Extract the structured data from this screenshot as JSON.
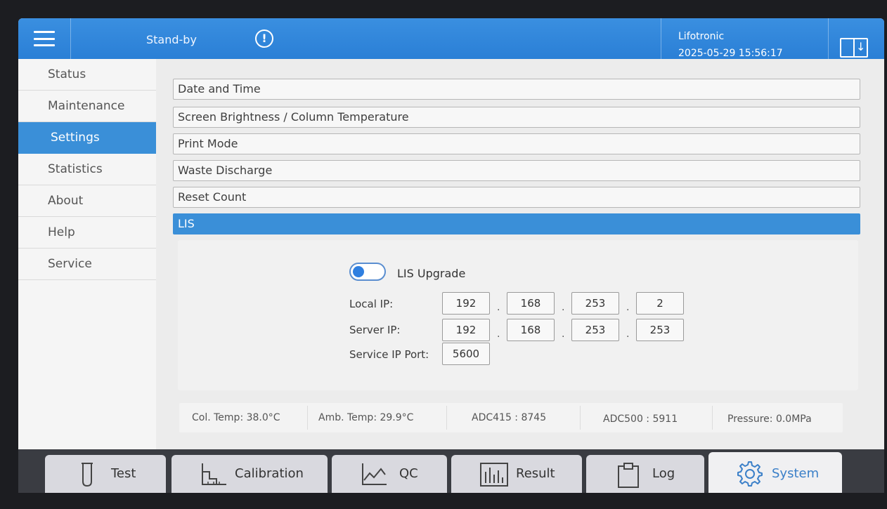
{
  "header": {
    "status": "Stand-by",
    "user": "Lifotronic",
    "datetime": "2025-05-29 15:56:17"
  },
  "sidebar": {
    "items": [
      {
        "label": "Status"
      },
      {
        "label": "Maintenance"
      },
      {
        "label": "Settings",
        "active": true
      },
      {
        "label": "Statistics"
      },
      {
        "label": "About"
      },
      {
        "label": "Help"
      },
      {
        "label": "Service"
      }
    ]
  },
  "settings": {
    "rows": [
      {
        "label": "Date and Time"
      },
      {
        "label": "Screen Brightness / Column Temperature"
      },
      {
        "label": "Print Mode"
      },
      {
        "label": "Waste Discharge"
      },
      {
        "label": "Reset Count"
      },
      {
        "label": "LIS",
        "active": true
      }
    ]
  },
  "lis": {
    "upgrade_label": "LIS Upgrade",
    "upgrade_enabled": false,
    "local_ip_label": "Local IP:",
    "local_ip": [
      "192",
      "168",
      "253",
      "2"
    ],
    "server_ip_label": "Server IP:",
    "server_ip": [
      "192",
      "168",
      "253",
      "253"
    ],
    "port_label": "Service IP Port:",
    "port": "5600",
    "separator": "."
  },
  "statusbar": {
    "col_temp": "Col. Temp:  38.0°C",
    "amb_temp": "Amb. Temp:  29.9°C",
    "adc415": "ADC415  : 8745",
    "adc500": "ADC500  : 5911",
    "pressure": "Pressure:  0.0MPa"
  },
  "bottom_nav": {
    "tabs": [
      {
        "label": "Test",
        "icon": "test-tube-icon"
      },
      {
        "label": "Calibration",
        "icon": "calibration-icon"
      },
      {
        "label": "QC",
        "icon": "line-chart-icon"
      },
      {
        "label": "Result",
        "icon": "bar-chart-icon"
      },
      {
        "label": "Log",
        "icon": "clipboard-icon"
      },
      {
        "label": "System",
        "icon": "gear-icon",
        "active": true
      }
    ]
  },
  "colors": {
    "accent": "#3a8fd8",
    "header": "#2a7fd6",
    "background": "#ececec"
  }
}
